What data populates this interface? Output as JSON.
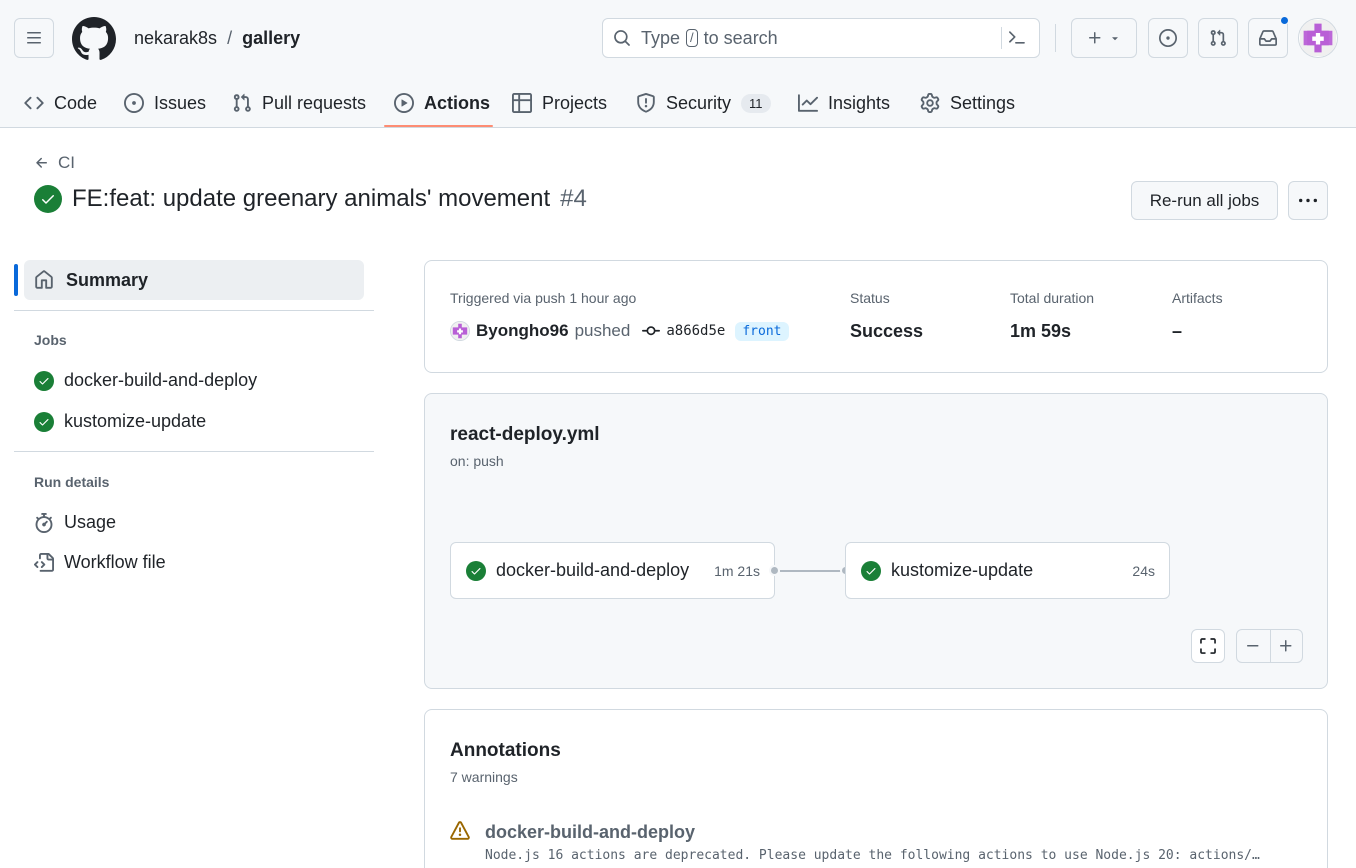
{
  "header": {
    "owner": "nekarak8s",
    "separator": "/",
    "repo": "gallery",
    "search_prefix": "Type",
    "search_key": "/",
    "search_suffix": "to search"
  },
  "tabs": [
    {
      "label": "Code",
      "icon": "code-icon"
    },
    {
      "label": "Issues",
      "icon": "issue-opened-icon"
    },
    {
      "label": "Pull requests",
      "icon": "git-pull-request-icon"
    },
    {
      "label": "Actions",
      "icon": "play-icon"
    },
    {
      "label": "Projects",
      "icon": "table-icon"
    },
    {
      "label": "Security",
      "icon": "shield-icon",
      "counter": "11"
    },
    {
      "label": "Insights",
      "icon": "graph-icon"
    },
    {
      "label": "Settings",
      "icon": "gear-icon"
    }
  ],
  "run": {
    "back_label": "CI",
    "title": "FE:feat: update greenary animals' movement",
    "number": "#4",
    "rerun_label": "Re-run all jobs"
  },
  "sidebar": {
    "summary_label": "Summary",
    "jobs_heading": "Jobs",
    "jobs": [
      "docker-build-and-deploy",
      "kustomize-update"
    ],
    "run_details_heading": "Run details",
    "usage_label": "Usage",
    "workflow_file_label": "Workflow file"
  },
  "summary": {
    "trigger_label": "Triggered via push 1 hour ago",
    "actor": "Byongho96",
    "action": "pushed",
    "sha": "a866d5e",
    "branch": "front",
    "status_label": "Status",
    "status_value": "Success",
    "duration_label": "Total duration",
    "duration_value": "1m 59s",
    "artifacts_label": "Artifacts",
    "artifacts_value": "–"
  },
  "workflow": {
    "file": "react-deploy.yml",
    "trigger": "on: push",
    "jobs": [
      {
        "name": "docker-build-and-deploy",
        "duration": "1m 21s",
        "status": "success"
      },
      {
        "name": "kustomize-update",
        "duration": "24s",
        "status": "success"
      }
    ]
  },
  "annotations": {
    "title": "Annotations",
    "count_label": "7 warnings",
    "items": [
      {
        "job": "docker-build-and-deploy",
        "message": "Node.js 16 actions are deprecated. Please update the following actions to use Node.js 20: actions/…"
      }
    ]
  },
  "colors": {
    "success": "#1a7f37",
    "accent": "#0969da",
    "tab_underline": "#fd8c73",
    "warning": "#9a6700"
  }
}
